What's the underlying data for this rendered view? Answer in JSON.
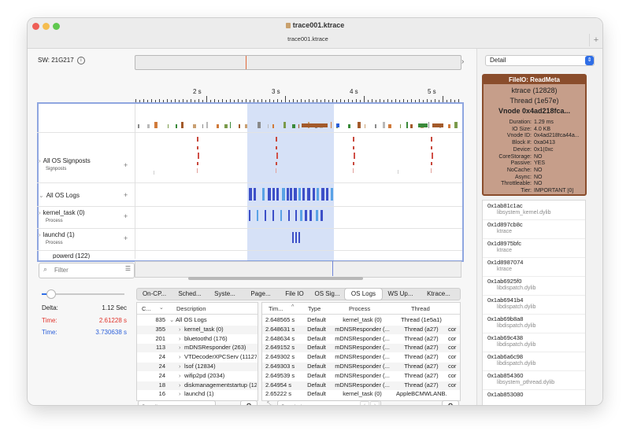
{
  "window": {
    "title": "trace001.ktrace",
    "tab_title": "trace001.ktrace",
    "new_tab": "+"
  },
  "sw": {
    "label": "SW: 21G217",
    "info": "i"
  },
  "ruler": {
    "labels": [
      "2 s",
      "3 s",
      "4 s",
      "5 s"
    ]
  },
  "lanes": [
    {
      "title": "All OS Signposts",
      "subtitle": "Signposts",
      "add": "+"
    },
    {
      "title": "All OS Logs",
      "subtitle": "",
      "add": "+"
    },
    {
      "title": "kernel_task (0)",
      "subtitle": "Process",
      "add": "+"
    },
    {
      "title": "launchd (1)",
      "subtitle": "Process",
      "add": "+"
    },
    {
      "title": "powerd (122)",
      "subtitle": "",
      "add": ""
    }
  ],
  "filter": {
    "placeholder": "Filter"
  },
  "stats": {
    "delta_label": "Delta:",
    "delta_value": "1.12 Sec",
    "time1_label": "Time:",
    "time1_value": "2.61228 s",
    "time2_label": "Time:",
    "time2_value": "3.730638 s",
    "colors": {
      "red": "#e0332b",
      "blue": "#2b5fd9"
    }
  },
  "tabs": [
    {
      "label": "On-CP..."
    },
    {
      "label": "Sched..."
    },
    {
      "label": "Syste..."
    },
    {
      "label": "Page..."
    },
    {
      "label": "File IO"
    },
    {
      "label": "OS Sig..."
    },
    {
      "label": "OS Logs"
    },
    {
      "label": "WS Up..."
    },
    {
      "label": "Ktrace..."
    }
  ],
  "left_table": {
    "headers": {
      "count": "C...",
      "description": "Description"
    },
    "rows": [
      {
        "count": "835",
        "description": "All OS Logs"
      },
      {
        "count": "355",
        "description": "kernel_task (0)"
      },
      {
        "count": "201",
        "description": "bluetoothd (176)"
      },
      {
        "count": "113",
        "description": "mDNSResponder (263)"
      },
      {
        "count": "24",
        "description": "VTDecoderXPCServ (11127)"
      },
      {
        "count": "24",
        "description": "lsof (12834)"
      },
      {
        "count": "24",
        "description": "wifip2pd (2034)"
      },
      {
        "count": "18",
        "description": "diskmanagementstartup (128"
      },
      {
        "count": "16",
        "description": "launchd (1)"
      }
    ],
    "filter_placeholder": "Filter Messages"
  },
  "right_table": {
    "headers": {
      "time": "Tim...",
      "type": "Type",
      "process": "Process",
      "thread": "Thread"
    },
    "rows": [
      {
        "time": "2.648565 s",
        "type": "Default",
        "process": "kernel_task (0)",
        "thread": "Thread (1e5a1)",
        "extra": ""
      },
      {
        "time": "2.648631 s",
        "type": "Default",
        "process": "mDNSResponder (...",
        "thread": "Thread (a27)",
        "extra": "cor"
      },
      {
        "time": "2.648634 s",
        "type": "Default",
        "process": "mDNSResponder (...",
        "thread": "Thread (a27)",
        "extra": "cor"
      },
      {
        "time": "2.649152 s",
        "type": "Default",
        "process": "mDNSResponder (...",
        "thread": "Thread (a27)",
        "extra": "cor"
      },
      {
        "time": "2.649302 s",
        "type": "Default",
        "process": "mDNSResponder (...",
        "thread": "Thread (a27)",
        "extra": "cor"
      },
      {
        "time": "2.649303 s",
        "type": "Default",
        "process": "mDNSResponder (...",
        "thread": "Thread (a27)",
        "extra": "cor"
      },
      {
        "time": "2.649539 s",
        "type": "Default",
        "process": "mDNSResponder (...",
        "thread": "Thread (a27)",
        "extra": "cor"
      },
      {
        "time": "2.64954 s",
        "type": "Default",
        "process": "mDNSResponder (...",
        "thread": "Thread (a27)",
        "extra": "cor"
      },
      {
        "time": "2.65222 s",
        "type": "Default",
        "process": "kernel_task (0)",
        "thread": "AppleBCMWLANB...",
        "extra": ""
      }
    ],
    "find_placeholder": "Find Message"
  },
  "inspector": {
    "mode": "Detail",
    "card": {
      "title": "FileIO: ReadMeta",
      "process": "ktrace (12828)",
      "thread": "Thread (1e57e)",
      "vnode": "Vnode 0x4ad218fca...",
      "fields": [
        {
          "k": "Duration:",
          "v": "1.29 ms"
        },
        {
          "k": "IO Size:",
          "v": "4.0 KB"
        },
        {
          "k": "Vnode ID:",
          "v": "0x4ad218fca44a..."
        },
        {
          "k": "Block #:",
          "v": "0xa0413"
        },
        {
          "k": "Device:",
          "v": "0x1(0xc"
        },
        {
          "k": "CoreStorage:",
          "v": "NO"
        },
        {
          "k": "Passive:",
          "v": "YES"
        },
        {
          "k": "NoCache:",
          "v": "NO"
        },
        {
          "k": "Async:",
          "v": "NO"
        },
        {
          "k": "Throttleable:",
          "v": "NO"
        },
        {
          "k": "Tier:",
          "v": "IMPORTANT [0]"
        }
      ],
      "colors": {
        "header": "#8a4d2c",
        "body": "#c69e8a"
      }
    },
    "stack": [
      {
        "addr": "0x1ab81c1ac",
        "lib": "libsystem_kernel.dylib"
      },
      {
        "addr": "0x1d897cb8c",
        "lib": "ktrace"
      },
      {
        "addr": "0x1d8975bfc",
        "lib": "ktrace"
      },
      {
        "addr": "0x1d8987074",
        "lib": "ktrace"
      },
      {
        "addr": "0x1ab6925f0",
        "lib": "libdispatch.dylib"
      },
      {
        "addr": "0x1ab6941b4",
        "lib": "libdispatch.dylib"
      },
      {
        "addr": "0x1ab69b8a8",
        "lib": "libdispatch.dylib"
      },
      {
        "addr": "0x1ab69c438",
        "lib": "libdispatch.dylib"
      },
      {
        "addr": "0x1ab6a6c98",
        "lib": "libdispatch.dylib"
      },
      {
        "addr": "0x1ab854360",
        "lib": "libsystem_pthread.dylib"
      },
      {
        "addr": "0x1ab853080",
        "lib": ""
      }
    ]
  }
}
